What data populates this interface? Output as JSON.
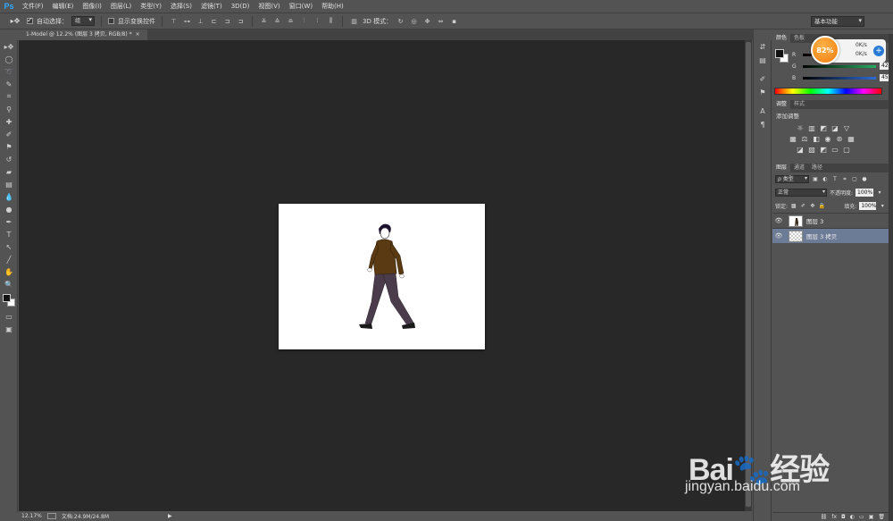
{
  "app": {
    "logo": "Ps",
    "menu": [
      "文件(F)",
      "编辑(E)",
      "图像(I)",
      "图层(L)",
      "类型(Y)",
      "选择(S)",
      "滤镜(T)",
      "3D(D)",
      "视图(V)",
      "窗口(W)",
      "帮助(H)"
    ]
  },
  "options": {
    "auto_select_label": "自动选择：",
    "auto_select_value": "组",
    "show_transform_label": "显示变换控件",
    "mode_3d_label": "3D 模式：",
    "workspace": "基本功能"
  },
  "document_tab": {
    "title": "1-Model @ 12.2% (图层 3 拷贝, RGB/8) *",
    "close": "×"
  },
  "status": {
    "zoom": "12.17%",
    "doc_info": "文档:24.9M/24.8M",
    "arrow": "▶"
  },
  "color_panel": {
    "tabs": [
      "颜色",
      "色板"
    ],
    "r_label": "R",
    "g_label": "G",
    "b_label": "B",
    "g_value": "42",
    "b_value": "45"
  },
  "speed_widget": {
    "percent": "82%",
    "up": "0K/s",
    "down": "0K/s",
    "plus": "+"
  },
  "adjust_panel": {
    "tabs": [
      "调整",
      "样式"
    ],
    "title": "添加调整"
  },
  "layers_panel": {
    "tabs": [
      "图层",
      "通道",
      "路径"
    ],
    "filter_label": "ρ 类型",
    "blend_mode": "正常",
    "opacity_label": "不透明度:",
    "opacity_value": "100%",
    "lock_label": "锁定:",
    "fill_label": "填充:",
    "fill_value": "100%",
    "layers": [
      {
        "name": "图层 3",
        "selected": false
      },
      {
        "name": "图层 3 拷贝",
        "selected": true
      }
    ],
    "footer_icons": [
      "⛓",
      "fx",
      "◘",
      "◐",
      "▭",
      "▣",
      "🗑"
    ]
  },
  "colors": {
    "slider_r": "#c0392b",
    "slider_g": "#27ae60",
    "slider_b": "#2e6bd6",
    "selected_layer": "#6d7c96",
    "canvas_bg": "#282828",
    "jacket": "#5a3a12",
    "trousers": "#4a3c4a"
  },
  "watermark": {
    "brand": "Bai🐾经验",
    "url": "jingyan.baidu.com"
  }
}
